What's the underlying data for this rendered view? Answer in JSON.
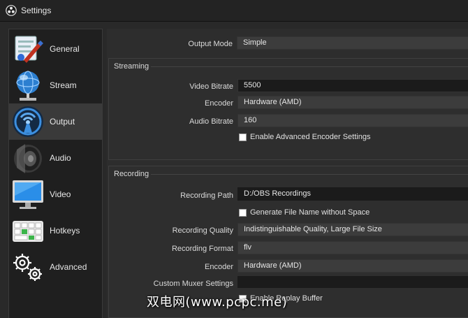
{
  "window": {
    "title": "Settings"
  },
  "sidebar": {
    "items": [
      {
        "label": "General",
        "icon": "general-settings-icon"
      },
      {
        "label": "Stream",
        "icon": "globe-stream-icon"
      },
      {
        "label": "Output",
        "icon": "broadcast-output-icon"
      },
      {
        "label": "Audio",
        "icon": "speaker-icon"
      },
      {
        "label": "Video",
        "icon": "monitor-icon"
      },
      {
        "label": "Hotkeys",
        "icon": "keyboard-icon"
      },
      {
        "label": "Advanced",
        "icon": "gears-icon"
      }
    ],
    "active": "Output"
  },
  "output": {
    "mode_label": "Output Mode",
    "mode_value": "Simple",
    "streaming": {
      "title": "Streaming",
      "video_bitrate_label": "Video Bitrate",
      "video_bitrate_value": "5500",
      "encoder_label": "Encoder",
      "encoder_value": "Hardware (AMD)",
      "audio_bitrate_label": "Audio Bitrate",
      "audio_bitrate_value": "160",
      "advanced_encoder_label": "Enable Advanced Encoder Settings"
    },
    "recording": {
      "title": "Recording",
      "path_label": "Recording Path",
      "path_value": "D:/OBS Recordings",
      "no_space_label": "Generate File Name without Space",
      "quality_label": "Recording Quality",
      "quality_value": "Indistinguishable Quality, Large File Size",
      "format_label": "Recording Format",
      "format_value": "flv",
      "encoder_label": "Encoder",
      "encoder_value": "Hardware (AMD)",
      "muxer_label": "Custom Muxer Settings",
      "muxer_value": "",
      "replay_label": "Enable Replay Buffer"
    }
  },
  "watermark": "双电网(www.pcpc.me)"
}
